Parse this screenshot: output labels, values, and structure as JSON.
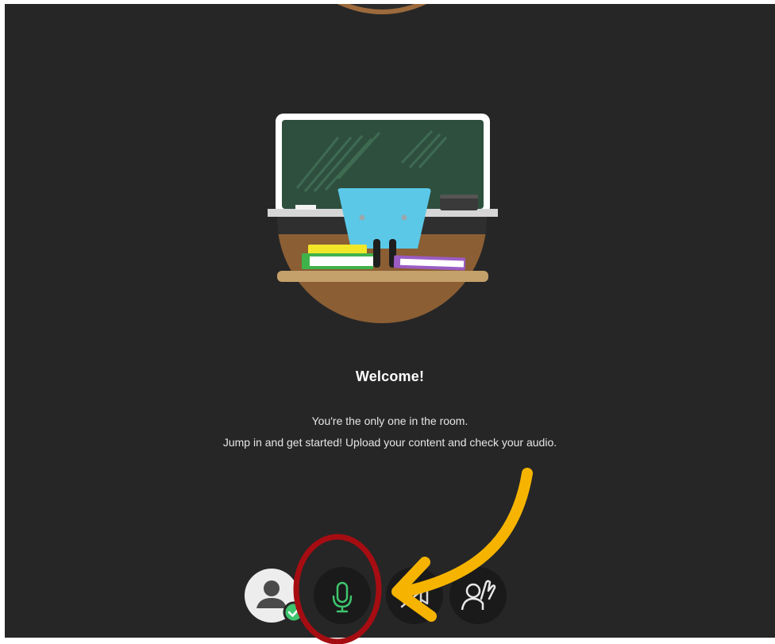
{
  "welcome": {
    "title": "Welcome!",
    "line1": "You're the only one in the room.",
    "line2": "Jump in and get started! Upload your content and check your audio."
  },
  "colors": {
    "background": "#262626",
    "mic_active": "#3ec46d",
    "status_check": "#3ec46d",
    "annotation_arrow": "#f6b400",
    "annotation_circle": "#a60d12"
  },
  "controls": [
    {
      "name": "avatar",
      "icon": "user-icon",
      "status_icon": "check-icon"
    },
    {
      "name": "microphone",
      "icon": "microphone-icon"
    },
    {
      "name": "camera",
      "icon": "camera-icon"
    },
    {
      "name": "raise-hand",
      "icon": "raise-hand-icon"
    }
  ]
}
